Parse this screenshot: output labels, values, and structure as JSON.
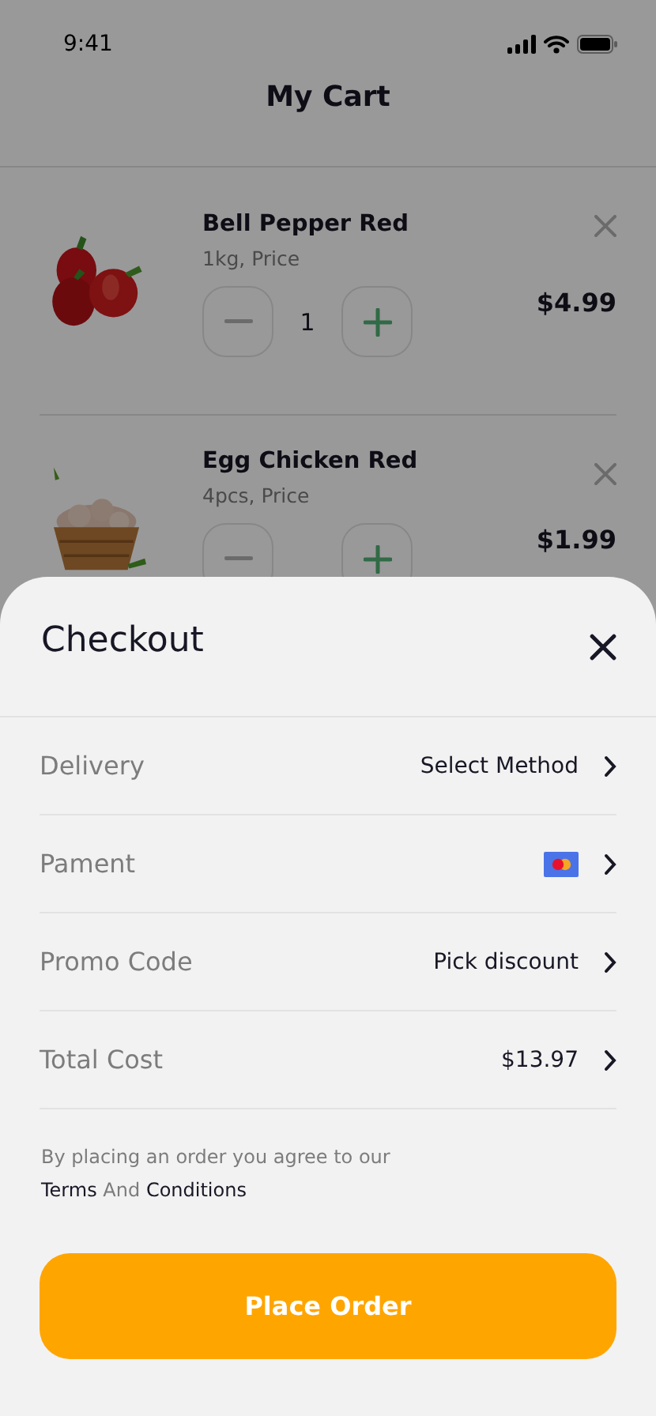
{
  "status_bar": {
    "time": "9:41"
  },
  "header": {
    "title": "My Cart"
  },
  "cart_items": [
    {
      "name": "Bell Pepper Red",
      "detail": "1kg, Price",
      "quantity": "1",
      "price": "$4.99"
    },
    {
      "name": "Egg Chicken Red",
      "detail": "4pcs, Price",
      "price": "$1.99"
    }
  ],
  "checkout": {
    "title": "Checkout",
    "rows": [
      {
        "kind": "text",
        "label": "Delivery",
        "value": "Select Method"
      },
      {
        "kind": "card",
        "label": "Pament"
      },
      {
        "kind": "text",
        "label": "Promo Code",
        "value": "Pick discount"
      },
      {
        "kind": "text",
        "label": "Total Cost",
        "value": "$13.97"
      }
    ],
    "agreement": [
      {
        "kind": "text",
        "text": "By placing an order you agree to our"
      },
      {
        "kind": "link",
        "text": "Terms"
      },
      {
        "kind": "text",
        "text": "And"
      },
      {
        "kind": "link",
        "text": "Conditions"
      }
    ],
    "button": "Place Order"
  }
}
